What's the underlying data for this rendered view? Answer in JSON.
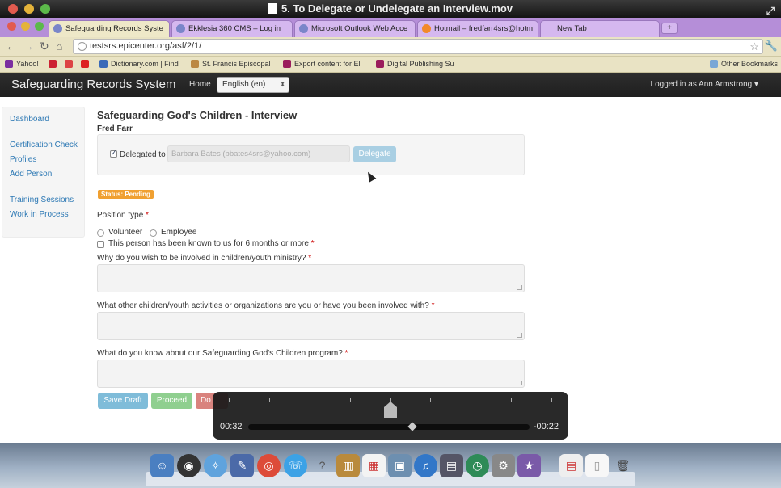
{
  "player": {
    "title": "5. To Delegate or Undelegate an Interview.mov",
    "elapsed": "00:32",
    "remaining": "-00:22",
    "progress_fraction": 0.59
  },
  "browser": {
    "tabs": [
      {
        "label": "Safeguarding Records Syste",
        "active": true
      },
      {
        "label": "Ekklesia 360 CMS – Log in",
        "active": false
      },
      {
        "label": "Microsoft Outlook Web Acce",
        "active": false
      },
      {
        "label": "Hotmail – fredfarr4srs@hotm",
        "active": false
      },
      {
        "label": "New Tab",
        "active": false
      }
    ],
    "new_tab_label": "+",
    "url": "testsrs.epicenter.org/asf/2/1/",
    "bookmarks": [
      "Yahoo!",
      "Dictionary.com | Find",
      "St. Francis Episcopal",
      "Export content for El",
      "Digital Publishing Su"
    ],
    "other_bookmarks": "Other Bookmarks"
  },
  "app": {
    "brand": "Safeguarding Records System",
    "home": "Home",
    "language": "English (en)",
    "logged_in": "Logged in as Ann Armstrong"
  },
  "sidebar": {
    "items": [
      "Dashboard",
      "Certification Check",
      "Profiles",
      "Add Person",
      "Training Sessions",
      "Work in Process"
    ]
  },
  "form": {
    "title": "Safeguarding God's Children - Interview",
    "person": "Fred Farr",
    "delegated_label": "Delegated to",
    "delegated_checked": true,
    "delegate_value": "Barbara Bates (bbates4srs@yahoo.com)",
    "delegate_button": "Delegate",
    "status": "Status: Pending",
    "position_type_label": "Position type",
    "position_options": [
      "Volunteer",
      "Employee"
    ],
    "known_label": "This person has been known to us for 6 months or more",
    "q1": "Why do you wish to be involved in children/youth ministry?",
    "q2": "What other children/youth activities or organizations are you or have you been involved with?",
    "q3": "What do you know about our Safeguarding God's Children program?",
    "save_draft": "Save Draft",
    "proceed": "Proceed",
    "third_button": "Do"
  },
  "colors": {
    "tab_strip": "#b58ed8",
    "navbar": "#222222",
    "link": "#2c78b4",
    "status_badge": "#f0a031",
    "btn_save": "#7fbcd9",
    "btn_proceed": "#8fcf8f",
    "btn_third": "#d9837e"
  }
}
